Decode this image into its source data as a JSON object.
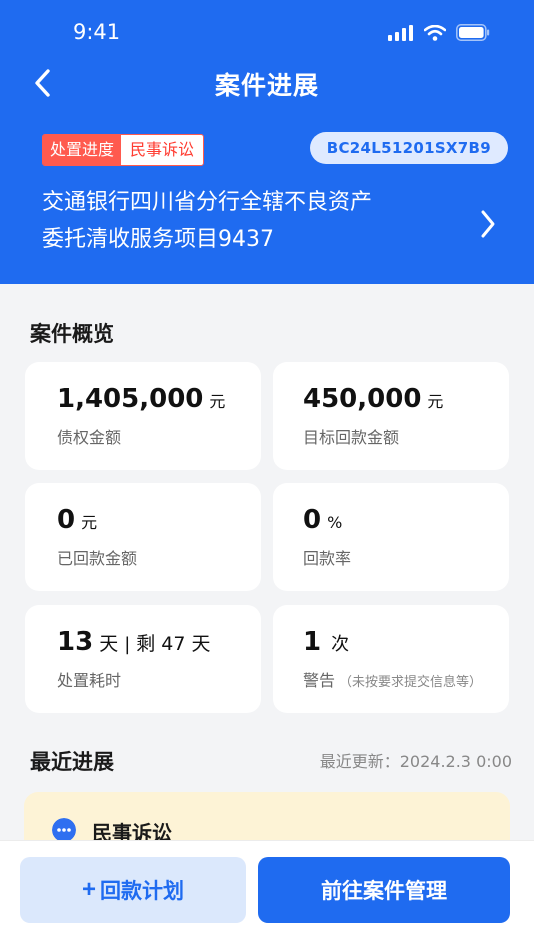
{
  "status": {
    "time": "9:41"
  },
  "nav": {
    "title": "案件进展"
  },
  "case": {
    "tag_left": "处置进度",
    "tag_right": "民事诉讼",
    "code": "BC24L51201SX7B9",
    "title_line1": "交通银行四川省分行全辖不良资产",
    "title_line2": "委托清收服务项目9437"
  },
  "overview": {
    "title": "案件概览",
    "cards": [
      {
        "value": "1,405,000",
        "unit": "元",
        "label": "债权金额"
      },
      {
        "value": "450,000",
        "unit": "元",
        "label": "目标回款金额"
      },
      {
        "value": "0",
        "unit": "元",
        "label": "已回款金额"
      },
      {
        "value": "0",
        "unit": "%",
        "label": "回款率"
      },
      {
        "value": "13",
        "unit": "天",
        "sep": "|",
        "extra_prefix": "剩",
        "extra_value": "47",
        "extra_unit": "天",
        "label": "处置耗时"
      },
      {
        "value": "1",
        "unit": "次",
        "label": "警告",
        "note": "（未按要求提交信息等）"
      }
    ]
  },
  "recent": {
    "title": "最近进展",
    "update_label": "最近更新：",
    "update_time": "2024.2.3 0:00",
    "item_label": "民事诉讼"
  },
  "actions": {
    "plus": "+",
    "plan_label": "回款计划",
    "manage_label": "前往案件管理"
  },
  "colors": {
    "primary": "#1f6bf0",
    "tag_red": "#ff5a4e",
    "progress_bg": "#fdf3d6"
  }
}
